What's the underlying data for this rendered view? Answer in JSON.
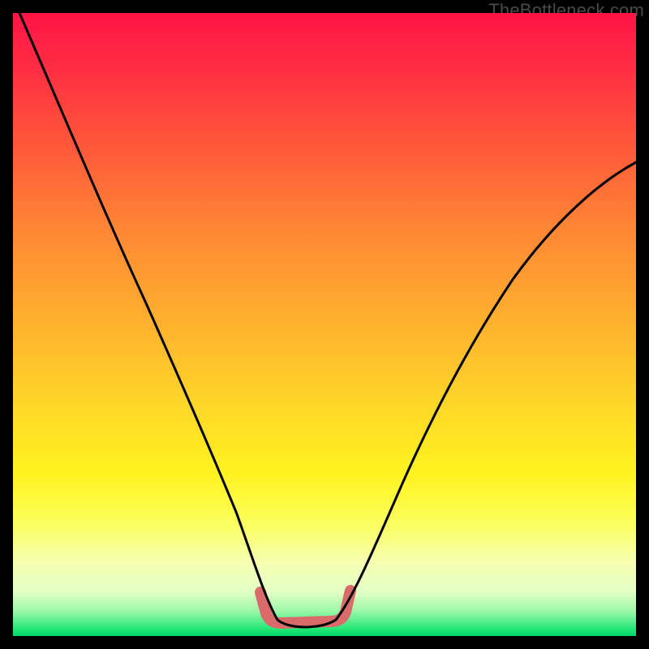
{
  "watermark": "TheBottleneck.com",
  "colors": {
    "frame": "#000000",
    "gradient_top": "#ff1445",
    "gradient_bottom": "#04d46a",
    "curve": "#000000",
    "valley_marker": "#d96b6b"
  },
  "chart_data": {
    "type": "line",
    "title": "",
    "xlabel": "",
    "ylabel": "",
    "xlim": [
      0,
      100
    ],
    "ylim": [
      0,
      100
    ],
    "grid": false,
    "series": [
      {
        "name": "bottleneck-curve",
        "x": [
          0,
          5,
          10,
          15,
          20,
          25,
          30,
          35,
          38,
          41,
          44,
          47,
          50,
          53,
          57,
          62,
          67,
          72,
          77,
          82,
          87,
          92,
          97,
          100
        ],
        "values": [
          100,
          89,
          79,
          69,
          59,
          49,
          39,
          27,
          19,
          11,
          5,
          2,
          2,
          4,
          10,
          19,
          28,
          37,
          45,
          53,
          60,
          66,
          70,
          72
        ]
      }
    ],
    "annotations": [
      {
        "name": "valley-marker",
        "x_range": [
          40,
          52
        ],
        "y": 2,
        "color": "#d96b6b"
      }
    ]
  }
}
